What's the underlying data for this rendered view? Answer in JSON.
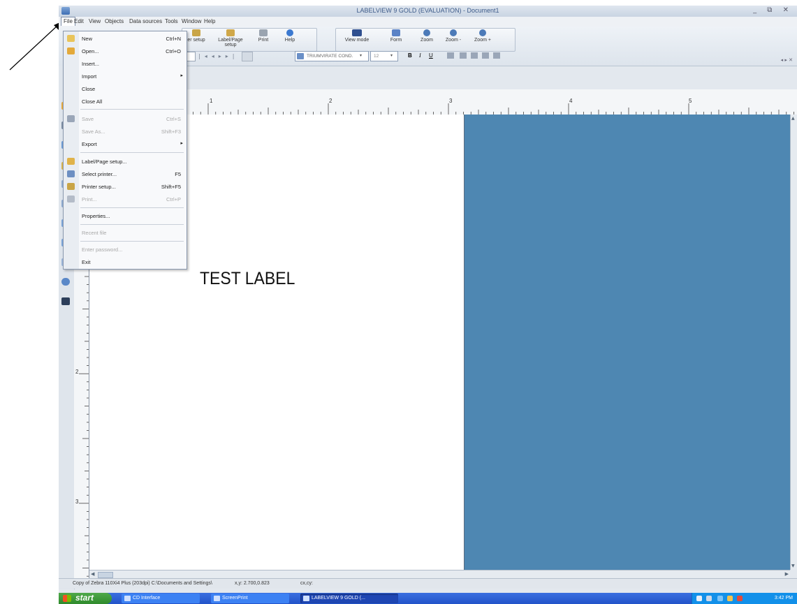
{
  "window": {
    "title": "LABELVIEW 9 GOLD (EVALUATION) - Document1",
    "controls": "_ ⧉ ✕"
  },
  "menubar": [
    "File",
    "Edit",
    "View",
    "Objects",
    "Data sources",
    "Tools",
    "Window",
    "Help"
  ],
  "ribbon": {
    "buttons": [
      "er setup",
      "Label/Page setup",
      "Print",
      "Help",
      "View mode",
      "Form",
      "Zoom",
      "Zoom -",
      "Zoom +"
    ],
    "font_name": "TRIUMVIRATE COND.",
    "font_size": "12",
    "format_buttons": [
      "B",
      "I",
      "U"
    ]
  },
  "file_menu": [
    {
      "label": "New",
      "shortcut": "Ctrl+N",
      "icon": "new-document-icon",
      "disabled": false
    },
    {
      "label": "Open...",
      "shortcut": "Ctrl+O",
      "icon": "open-folder-icon",
      "disabled": false
    },
    {
      "label": "Insert...",
      "shortcut": "",
      "icon": "",
      "disabled": false
    },
    {
      "label": "Import",
      "shortcut": "",
      "icon": "",
      "disabled": false,
      "submenu": true
    },
    {
      "label": "Close",
      "shortcut": "",
      "icon": "",
      "disabled": false
    },
    {
      "label": "Close All",
      "shortcut": "",
      "icon": "",
      "disabled": false
    },
    {
      "label": "Save",
      "shortcut": "Ctrl+S",
      "icon": "save-icon",
      "disabled": true
    },
    {
      "label": "Save As...",
      "shortcut": "Shift+F3",
      "icon": "",
      "disabled": true
    },
    {
      "label": "Export",
      "shortcut": "",
      "icon": "",
      "disabled": false,
      "submenu": true
    },
    {
      "label": "Label/Page setup...",
      "shortcut": "",
      "icon": "page-setup-icon",
      "disabled": false
    },
    {
      "label": "Select printer...",
      "shortcut": "F5",
      "icon": "printer-select-icon",
      "disabled": false
    },
    {
      "label": "Printer setup...",
      "shortcut": "Shift+F5",
      "icon": "printer-setup-icon",
      "disabled": false
    },
    {
      "label": "Print...",
      "shortcut": "Ctrl+P",
      "icon": "print-icon",
      "disabled": true
    },
    {
      "label": "Properties...",
      "shortcut": "",
      "icon": "",
      "disabled": false
    },
    {
      "label": "Recent file",
      "shortcut": "",
      "icon": "",
      "disabled": true
    },
    {
      "label": "Enter password...",
      "shortcut": "",
      "icon": "",
      "disabled": true
    },
    {
      "label": "Exit",
      "shortcut": "",
      "icon": "",
      "disabled": false
    }
  ],
  "ruler": {
    "h_labels": [
      "1",
      "2",
      "3",
      "4",
      "5"
    ],
    "v_labels": [
      "2",
      "3"
    ]
  },
  "canvas": {
    "label_text": "TEST LABEL"
  },
  "statusbar": {
    "printer": "Copy of Zebra 110Xi4 Plus (203dpi) C:\\Documents and Settings\\",
    "coords": "x,y: 2.700,0.823",
    "size": "cx,cy:"
  },
  "taskbar": {
    "start_label": "start",
    "tasks": [
      "CD Interface",
      "ScreenPrint",
      "LABELVIEW 9 GOLD (..."
    ],
    "clock": "3:42 PM"
  },
  "colors": {
    "workspace": "#4e87b2",
    "taskbar": "#2253c9",
    "start": "#2f8a2c"
  }
}
